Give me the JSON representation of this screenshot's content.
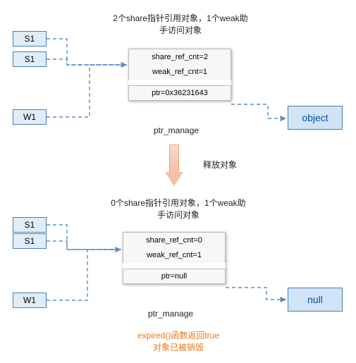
{
  "diagram": {
    "top": {
      "title": "2个share指针引用对象，1个weak助\n手访问对象",
      "pointers": {
        "s1a": "S1",
        "s1b": "S1",
        "w1": "W1"
      },
      "manager": {
        "share_cnt": "share_ref_cnt=2",
        "weak_cnt": "weak_ref_cnt=1",
        "ptr": "ptr=0x36231643",
        "label": "ptr_manage"
      },
      "object": "object"
    },
    "arrow_label": "释放对象",
    "bottom": {
      "title": "0个share指针引用对象，1个weak助\n手访问对象",
      "pointers": {
        "s1a": "S1",
        "s1b": "S1",
        "w1": "W1"
      },
      "manager": {
        "share_cnt": "share_ref_cnt=0",
        "weak_cnt": "weak_ref_cnt=1",
        "ptr": "ptr=null",
        "label": "ptr_manage"
      },
      "object": "null"
    },
    "footer": "expired()函数返回true\n对象已被销毁"
  }
}
